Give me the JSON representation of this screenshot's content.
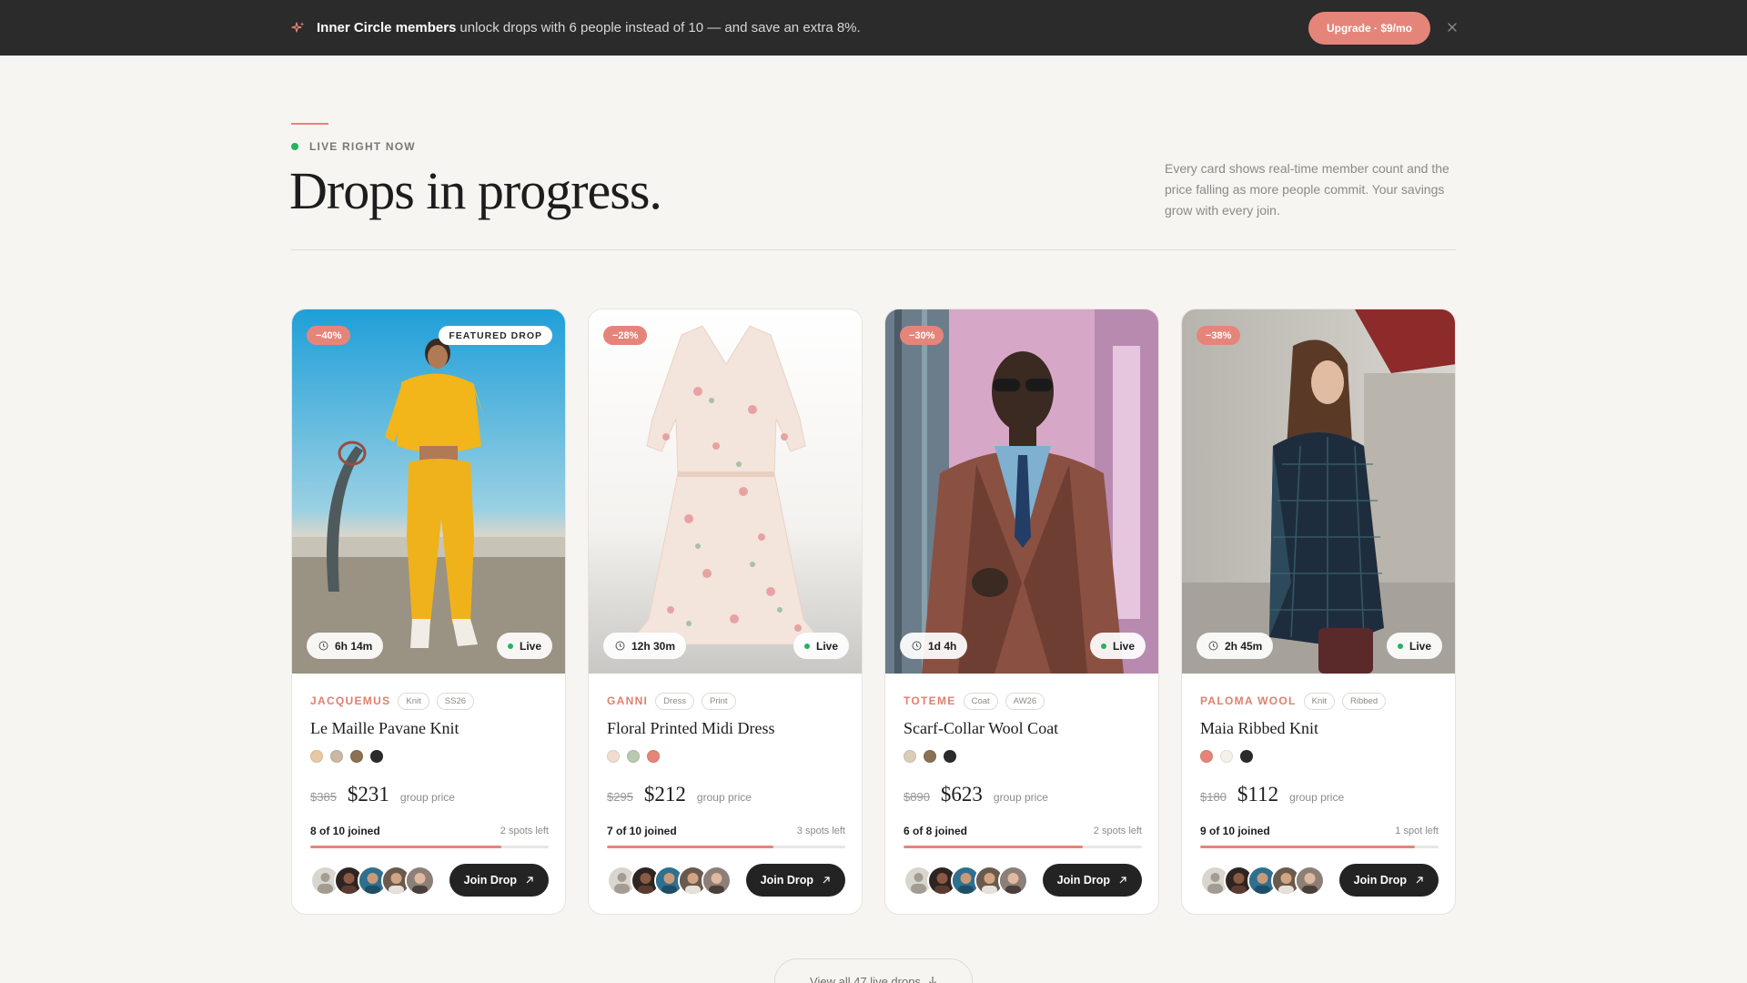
{
  "banner": {
    "strong": "Inner Circle members",
    "text": "unlock drops with 6 people instead of 10 — and save an extra 8%.",
    "upgrade_label": "Upgrade · $9/mo"
  },
  "header": {
    "eyebrow": "LIVE RIGHT NOW",
    "title": "Drops in progress.",
    "description": "Every card shows real-time member count and the price falling as more people commit. Your savings grow with every join."
  },
  "colors": {
    "accent": "#e5857a",
    "live": "#24b35f",
    "dark": "#232323"
  },
  "cards": [
    {
      "discount": "−40%",
      "featured": "FEATURED DROP",
      "timer": "6h 14m",
      "live": "Live",
      "brand": "JACQUEMUS",
      "tags": [
        "Knit",
        "SS26"
      ],
      "name": "Le Maille Pavane Knit",
      "swatches": [
        "#e8c9a3",
        "#c9b9a4",
        "#8a7154",
        "#2b2b2b"
      ],
      "old_price": "$385",
      "price": "$231",
      "price_note": "group price",
      "joined": "8 of 10 joined",
      "spots": "2 spots left",
      "progress": 0.8,
      "join_label": "Join Drop"
    },
    {
      "discount": "−28%",
      "featured": "",
      "timer": "12h 30m",
      "live": "Live",
      "brand": "GANNI",
      "tags": [
        "Dress",
        "Print"
      ],
      "name": "Floral Printed Midi Dress",
      "swatches": [
        "#f1ddd0",
        "#b9c9b1",
        "#e5857a"
      ],
      "old_price": "$295",
      "price": "$212",
      "price_note": "group price",
      "joined": "7 of 10 joined",
      "spots": "3 spots left",
      "progress": 0.7,
      "join_label": "Join Drop"
    },
    {
      "discount": "−30%",
      "featured": "",
      "timer": "1d 4h",
      "live": "Live",
      "brand": "TOTEME",
      "tags": [
        "Coat",
        "AW26"
      ],
      "name": "Scarf-Collar Wool Coat",
      "swatches": [
        "#d9ccb8",
        "#8a7154",
        "#2b2b2b"
      ],
      "old_price": "$890",
      "price": "$623",
      "price_note": "group price",
      "joined": "6 of 8 joined",
      "spots": "2 spots left",
      "progress": 0.75,
      "join_label": "Join Drop"
    },
    {
      "discount": "−38%",
      "featured": "",
      "timer": "2h 45m",
      "live": "Live",
      "brand": "PALOMA WOOL",
      "tags": [
        "Knit",
        "Ribbed"
      ],
      "name": "Maia Ribbed Knit",
      "swatches": [
        "#e5857a",
        "#f4f1ea",
        "#2b2b2b"
      ],
      "old_price": "$180",
      "price": "$112",
      "price_note": "group price",
      "joined": "9 of 10 joined",
      "spots": "1 spot left",
      "progress": 0.9,
      "join_label": "Join Drop"
    }
  ],
  "view_all_label": "View all 47 live drops"
}
